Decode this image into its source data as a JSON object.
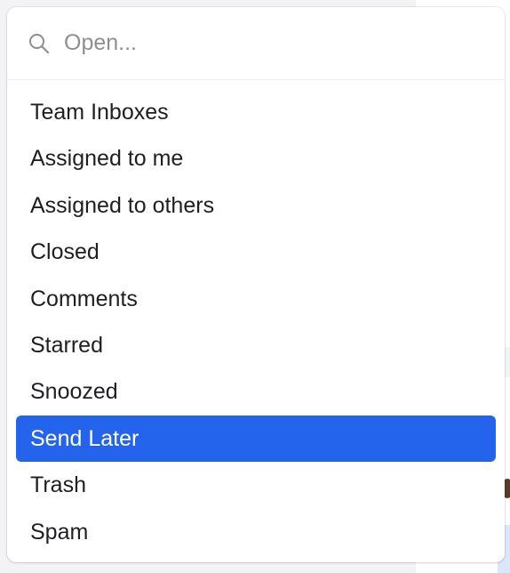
{
  "search": {
    "placeholder": "Open..."
  },
  "menu": {
    "items": [
      {
        "label": "Team Inboxes"
      },
      {
        "label": "Assigned to me"
      },
      {
        "label": "Assigned to others"
      },
      {
        "label": "Closed"
      },
      {
        "label": "Comments"
      },
      {
        "label": "Starred"
      },
      {
        "label": "Snoozed"
      },
      {
        "label": "Send Later",
        "selected": true
      },
      {
        "label": "Trash"
      },
      {
        "label": "Spam"
      }
    ]
  },
  "colors": {
    "selected_background": "#2463eb",
    "selected_text": "#ffffff",
    "item_text": "#1f1f23",
    "placeholder_text": "#8e8e93"
  },
  "icons": {
    "search": "magnifying-glass"
  }
}
